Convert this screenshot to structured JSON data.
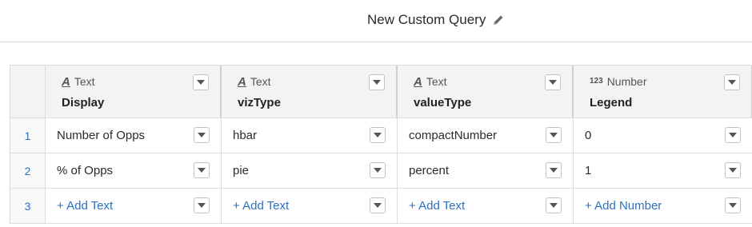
{
  "header": {
    "title": "New Custom Query",
    "edit_icon": "pencil-icon"
  },
  "columns": [
    {
      "type_icon": "A",
      "type": "Text",
      "name": "Display"
    },
    {
      "type_icon": "A",
      "type": "Text",
      "name": "vizType"
    },
    {
      "type_icon": "A",
      "type": "Text",
      "name": "valueType"
    },
    {
      "type_icon": "123",
      "type": "Number",
      "name": "Legend"
    }
  ],
  "rows": [
    {
      "num": "1",
      "cells": [
        "Number of Opps",
        "hbar",
        "compactNumber",
        "0"
      ]
    },
    {
      "num": "2",
      "cells": [
        "% of Opps",
        "pie",
        "percent",
        "1"
      ]
    },
    {
      "num": "3",
      "cells": [
        "+ Add Text",
        "+ Add Text",
        "+ Add Text",
        "+ Add Number"
      ]
    }
  ],
  "colors": {
    "link": "#2f6fbd",
    "header_bg": "#f3f3f3",
    "border": "#d8dde6"
  }
}
